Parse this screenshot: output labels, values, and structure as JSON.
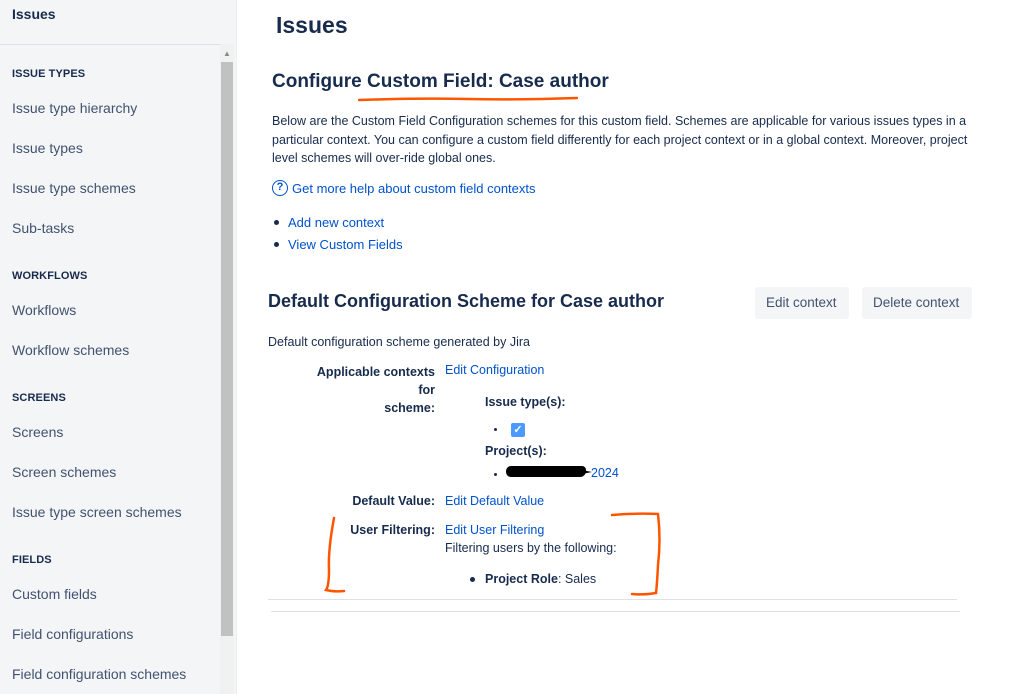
{
  "sidebar": {
    "top_item": "Issues",
    "sections": [
      {
        "heading": "ISSUE TYPES",
        "items": [
          "Issue type hierarchy",
          "Issue types",
          "Issue type schemes",
          "Sub-tasks"
        ]
      },
      {
        "heading": "WORKFLOWS",
        "items": [
          "Workflows",
          "Workflow schemes"
        ]
      },
      {
        "heading": "SCREENS",
        "items": [
          "Screens",
          "Screen schemes",
          "Issue type screen schemes"
        ]
      },
      {
        "heading": "FIELDS",
        "items": [
          "Custom fields",
          "Field configurations",
          "Field configuration schemes"
        ]
      }
    ]
  },
  "main": {
    "page_title": "Issues",
    "config_title_prefix": "Configure ",
    "config_title_field": "Custom Field: Case author",
    "description": "Below are the Custom Field Configuration schemes for this custom field. Schemes are applicable for various issues types in a particular context. You can configure a custom field differently for each project context or in a global context. Moreover, project level schemes will over-ride global ones.",
    "help_icon": "?",
    "help_link": "Get more help about custom field contexts",
    "links": [
      "Add new context",
      "View Custom Fields"
    ],
    "scheme": {
      "title": "Default Configuration Scheme for Case author",
      "edit_button": "Edit context",
      "delete_button": "Delete context",
      "description": "Default configuration scheme generated by Jira",
      "applicable_label_line1": "Applicable contexts for",
      "applicable_label_line2": "scheme:",
      "edit_configuration": "Edit Configuration",
      "issue_types_label": "Issue type(s):",
      "projects_label": "Project(s):",
      "project_suffix": "2024",
      "default_value_label": "Default Value:",
      "edit_default_value": "Edit Default Value",
      "user_filtering_label": "User Filtering:",
      "edit_user_filtering": "Edit User Filtering",
      "filtering_desc": "Filtering users by the following:",
      "project_role_label": "Project Role",
      "project_role_value": ": Sales"
    }
  },
  "colors": {
    "link": "#0052cc",
    "text": "#172b4d",
    "annotation": "#ff5500",
    "checkbox": "#4c9aff"
  }
}
